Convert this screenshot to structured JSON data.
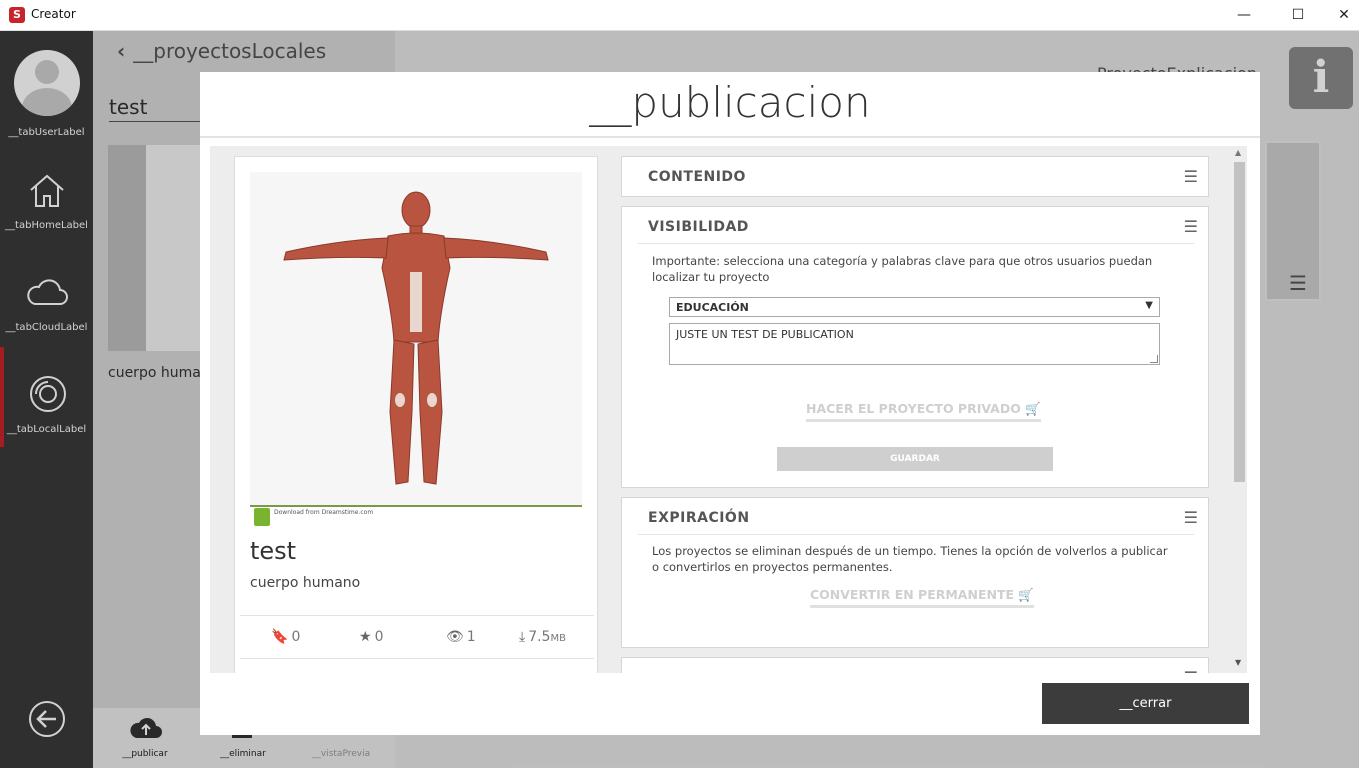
{
  "window": {
    "title": "Creator",
    "minimize": "—",
    "maximize": "☐",
    "close": "✕"
  },
  "sidebar": {
    "items": [
      {
        "label": "__tabUserLabel"
      },
      {
        "label": "__tabHomeLabel"
      },
      {
        "label": "__tabCloudLabel"
      },
      {
        "label": "__tabLocalLabel"
      }
    ]
  },
  "background": {
    "breadcrumb": "__proyectosLocales",
    "search_value": "test",
    "thumb_caption": "cuerpo human",
    "right_text": "ProyectoExplicacion",
    "info_glyph": "i",
    "bottom_actions": [
      {
        "label": "__publicar"
      },
      {
        "label": "__eliminar"
      },
      {
        "label": "__vistaPrevia"
      }
    ]
  },
  "modal": {
    "title": "__publicacion",
    "close_label": "__cerrar",
    "project": {
      "name": "test",
      "description": "cuerpo humano",
      "image_footer": "Download from Dreamstime.com",
      "stats": {
        "bookmarks": "0",
        "stars": "0",
        "views": "1",
        "size": "7.5",
        "size_unit": "MB"
      }
    },
    "panels": {
      "contenido": {
        "title": "CONTENIDO"
      },
      "visibilidad": {
        "title": "VISIBILIDAD",
        "info": "Importante: selecciona una categoría y palabras clave para que otros usuarios puedan localizar tu proyecto",
        "category_selected": "EDUCACIÓN",
        "keywords": "JUSTE UN TEST DE PUBLICATION",
        "private_button": "HACER EL PROYECTO PRIVADO",
        "save_button": "GUARDAR"
      },
      "expiracion": {
        "title": "EXPIRACIÓN",
        "info": "Los proyectos se eliminan después de un tiempo. Tienes la opción de volverlos a publicar o convertirlos en proyectos permanentes.",
        "permanent_button": "CONVERTIR EN PERMANENTE"
      }
    }
  },
  "colors": {
    "accent": "#c8242b",
    "sidebar": "#3a3a3a",
    "close_button": "#3c3c3c"
  }
}
